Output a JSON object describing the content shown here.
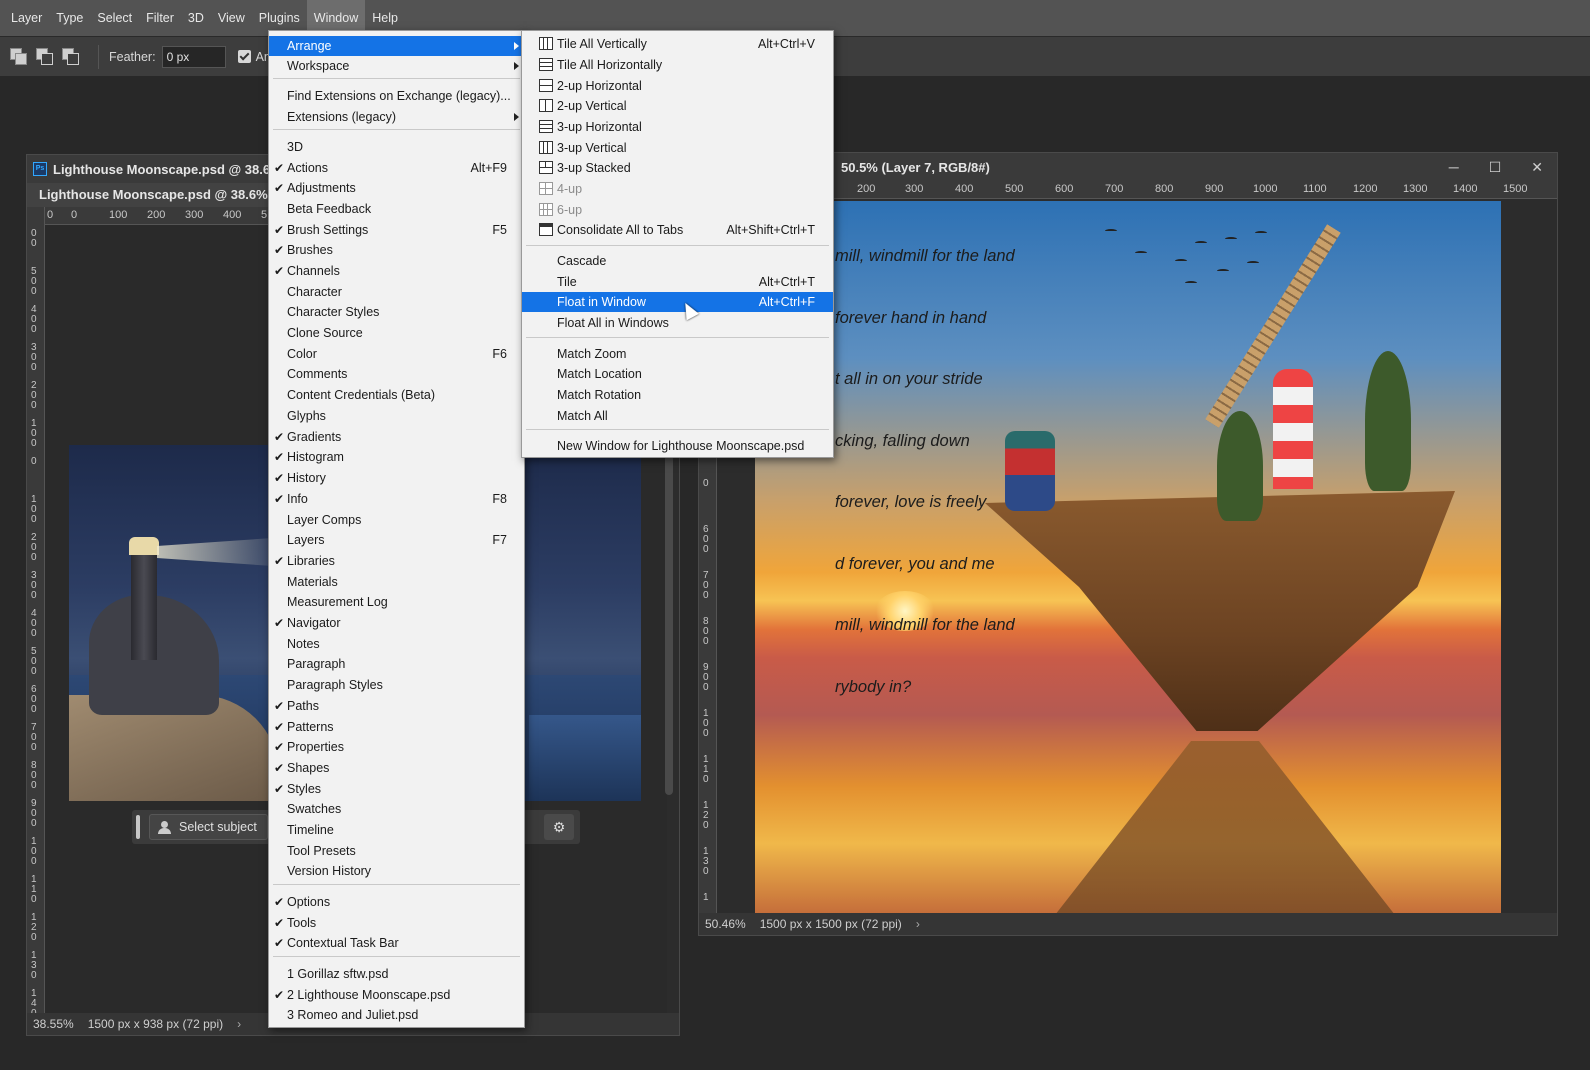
{
  "menubar": {
    "items": [
      "Layer",
      "Type",
      "Select",
      "Filter",
      "3D",
      "View",
      "Plugins",
      "Window",
      "Help"
    ],
    "active": "Window"
  },
  "options_bar": {
    "feather_label": "Feather:",
    "feather_value": "0 px",
    "antialias_label": "An"
  },
  "doc_left": {
    "window_title": "Lighthouse Moonscape.psd @ 38.6%",
    "tab_label": "Lighthouse Moonscape.psd @ 38.6% (",
    "ruler_h_ticks": [
      "0",
      "0",
      "100",
      "200",
      "300",
      "400",
      "5"
    ],
    "ruler_v_ticks": [
      "0\n0",
      "5\n0\n0",
      "4\n0\n0",
      "3\n0\n0",
      "2\n0\n0",
      "1\n0\n0",
      "0",
      "1\n0\n0",
      "2\n0\n0",
      "3\n0\n0",
      "4\n0\n0",
      "5\n0\n0",
      "6\n0\n0",
      "7\n0\n0",
      "8\n0\n0",
      "9\n0\n0",
      "1\n0\n0",
      "1\n1\n0",
      "1\n2\n0",
      "1\n3\n0",
      "1\n4\n0"
    ],
    "zoom": "38.55%",
    "doc_size": "1500 px x 938 px (72 ppi)",
    "status_chevron": "›"
  },
  "task_bar": {
    "select_subject_label": "Select subject",
    "settings_glyph": "⚙"
  },
  "doc_right": {
    "window_title": "50.5% (Layer 7, RGB/8#)",
    "title_prefix": "",
    "ruler_h_ticks": [
      "200",
      "300",
      "400",
      "500",
      "600",
      "700",
      "800",
      "900",
      "1000",
      "1100",
      "1200",
      "1300",
      "1400",
      "1500"
    ],
    "ruler_v_ticks": [
      "0",
      "6\n0\n0",
      "7\n0\n0",
      "8\n0\n0",
      "9\n0\n0",
      "1\n0\n0",
      "1\n1\n0",
      "1\n2\n0",
      "1\n3\n0",
      "1"
    ],
    "zoom": "50.46%",
    "doc_size": "1500 px x 1500 px (72 ppi)",
    "status_chevron": "›",
    "minimize": "─",
    "maximize": "☐",
    "close": "✕",
    "poem_lines": [
      "mill, windmill for the land",
      "forever hand in hand",
      "t all in on your stride",
      "cking, falling down",
      "forever, love is freely",
      "d forever, you and me",
      "mill, windmill for the land",
      "rybody in?"
    ]
  },
  "window_menu": {
    "items": [
      {
        "label": "Arrange",
        "submenu": true,
        "highlighted": true
      },
      {
        "label": "Workspace",
        "submenu": true
      },
      {
        "label": "Find Extensions on Exchange (legacy)..."
      },
      {
        "label": "Extensions (legacy)",
        "submenu": true
      },
      {
        "label": "3D"
      },
      {
        "label": "Actions",
        "checked": true,
        "shortcut": "Alt+F9"
      },
      {
        "label": "Adjustments",
        "checked": true
      },
      {
        "label": "Beta Feedback"
      },
      {
        "label": "Brush Settings",
        "checked": true,
        "shortcut": "F5"
      },
      {
        "label": "Brushes",
        "checked": true
      },
      {
        "label": "Channels",
        "checked": true
      },
      {
        "label": "Character"
      },
      {
        "label": "Character Styles"
      },
      {
        "label": "Clone Source"
      },
      {
        "label": "Color",
        "shortcut": "F6"
      },
      {
        "label": "Comments"
      },
      {
        "label": "Content Credentials (Beta)"
      },
      {
        "label": "Glyphs"
      },
      {
        "label": "Gradients",
        "checked": true
      },
      {
        "label": "Histogram",
        "checked": true
      },
      {
        "label": "History",
        "checked": true
      },
      {
        "label": "Info",
        "checked": true,
        "shortcut": "F8"
      },
      {
        "label": "Layer Comps"
      },
      {
        "label": "Layers",
        "shortcut": "F7"
      },
      {
        "label": "Libraries",
        "checked": true
      },
      {
        "label": "Materials"
      },
      {
        "label": "Measurement Log"
      },
      {
        "label": "Navigator",
        "checked": true
      },
      {
        "label": "Notes"
      },
      {
        "label": "Paragraph"
      },
      {
        "label": "Paragraph Styles"
      },
      {
        "label": "Paths",
        "checked": true
      },
      {
        "label": "Patterns",
        "checked": true
      },
      {
        "label": "Properties",
        "checked": true
      },
      {
        "label": "Shapes",
        "checked": true
      },
      {
        "label": "Styles",
        "checked": true
      },
      {
        "label": "Swatches"
      },
      {
        "label": "Timeline"
      },
      {
        "label": "Tool Presets"
      },
      {
        "label": "Version History"
      },
      {
        "label": "Options",
        "checked": true
      },
      {
        "label": "Tools",
        "checked": true
      },
      {
        "label": "Contextual Task Bar",
        "checked": true
      },
      {
        "label": "1 Gorillaz sftw.psd"
      },
      {
        "label": "2 Lighthouse Moonscape.psd",
        "checked": true
      },
      {
        "label": "3 Romeo and Juliet.psd"
      }
    ],
    "check_glyph": "✔"
  },
  "arrange_menu": {
    "items": [
      {
        "label": "Tile All Vertically",
        "shortcut": "Alt+Ctrl+V",
        "icon": "tile-vertical-icon"
      },
      {
        "label": "Tile All Horizontally",
        "icon": "tile-horizontal-icon"
      },
      {
        "label": "2-up Horizontal",
        "icon": "two-up-horizontal-icon"
      },
      {
        "label": "2-up Vertical",
        "icon": "two-up-vertical-icon"
      },
      {
        "label": "3-up Horizontal",
        "icon": "three-up-horizontal-icon"
      },
      {
        "label": "3-up Vertical",
        "icon": "three-up-vertical-icon"
      },
      {
        "label": "3-up Stacked",
        "icon": "three-up-stacked-icon"
      },
      {
        "label": "4-up",
        "disabled": true,
        "icon": "four-up-icon"
      },
      {
        "label": "6-up",
        "disabled": true,
        "icon": "six-up-icon"
      },
      {
        "label": "Consolidate All to Tabs",
        "shortcut": "Alt+Shift+Ctrl+T",
        "icon": "consolidate-tabs-icon"
      },
      {
        "label": "Cascade"
      },
      {
        "label": "Tile",
        "shortcut": "Alt+Ctrl+T"
      },
      {
        "label": "Float in Window",
        "shortcut": "Alt+Ctrl+F",
        "highlighted": true
      },
      {
        "label": "Float All in Windows"
      },
      {
        "label": "Match Zoom"
      },
      {
        "label": "Match Location"
      },
      {
        "label": "Match Rotation"
      },
      {
        "label": "Match All"
      },
      {
        "label": "New Window for Lighthouse Moonscape.psd"
      }
    ]
  },
  "colors": {
    "menu_highlight": "#1473e6",
    "menubar_bg": "#535353",
    "workspace_bg": "#282828"
  }
}
